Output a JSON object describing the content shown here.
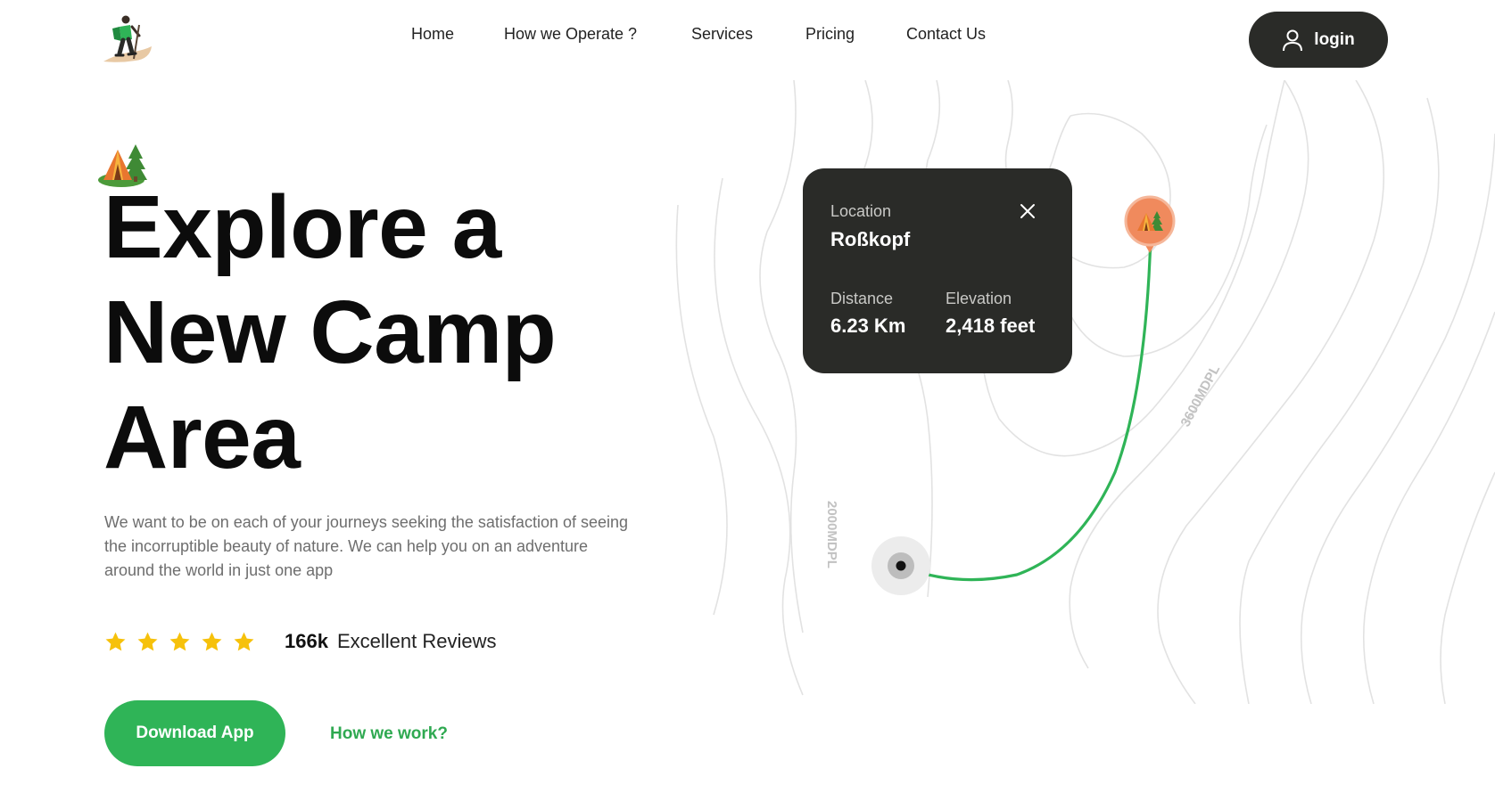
{
  "nav": {
    "items": [
      {
        "label": "Home"
      },
      {
        "label": "How we Operate ?"
      },
      {
        "label": "Services"
      },
      {
        "label": "Pricing"
      },
      {
        "label": "Contact Us"
      }
    ],
    "login_label": "login",
    "login_icon": "user-icon",
    "logo_icon": "hiker-logo-icon"
  },
  "hero": {
    "emoji_icon": "camp-tent-icon",
    "title_lines": [
      "Explore a",
      "New Camp",
      "Area"
    ],
    "description": "We want to be on each of your journeys seeking the satisfaction of seeing the incorruptible beauty of nature. We can help you on an adventure around the world in just one app",
    "rating": {
      "stars": 5,
      "count": "166k",
      "label": "Excellent Reviews",
      "star_color": "#f6c10b"
    },
    "download_label": "Download App",
    "how_label": "How we work?"
  },
  "map": {
    "contour_labels": [
      "3600MDPL",
      "2000MDPL"
    ],
    "route_color": "#2fb457",
    "pin_color": "#f08a5d",
    "pin_icon": "camp-tent-icon",
    "card": {
      "location_label": "Location",
      "location_value": "Roßkopf",
      "distance_label": "Distance",
      "distance_value": "6.23 Km",
      "elevation_label": "Elevation",
      "elevation_value": "2,418 feet",
      "close_icon": "close-icon"
    }
  },
  "colors": {
    "dark": "#2a2b28",
    "accent": "#2fb457"
  }
}
